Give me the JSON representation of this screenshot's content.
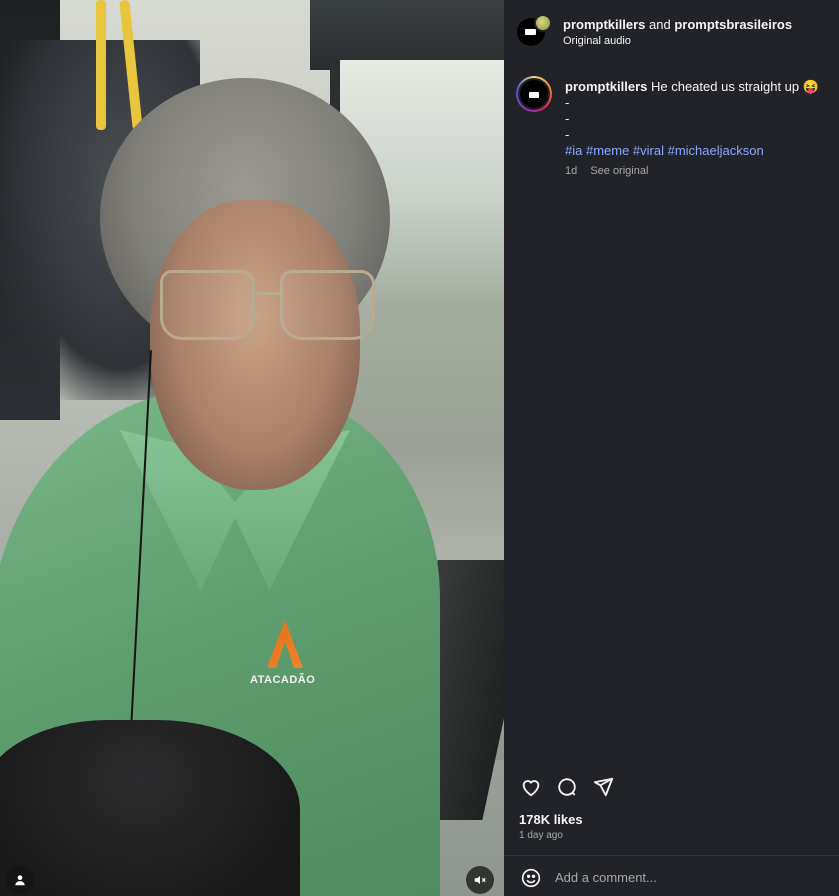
{
  "post": {
    "author_primary": "promptkillers",
    "joiner": "and",
    "author_secondary": "promptsbrasileiros",
    "audio": "Original audio"
  },
  "caption": {
    "username": "promptkillers",
    "text": "He cheated us straight up 😝",
    "lines": [
      "-",
      "-",
      "-"
    ],
    "hashtags": "#ia #meme #viral #michaeljackson",
    "time": "1d",
    "see_original": "See original"
  },
  "media": {
    "shirt_logo": "ATACADÃO"
  },
  "stats": {
    "likes": "178K likes",
    "ago": "1 day ago"
  },
  "comment": {
    "placeholder": "Add a comment..."
  },
  "icons": {
    "like": "heart-icon",
    "comment": "comment-icon",
    "share": "send-icon",
    "emoji": "smiley-icon",
    "user": "user-icon",
    "mute": "speaker-muted-icon"
  },
  "colors": {
    "panel_bg": "#212328",
    "hashtag": "#8aa7ff",
    "muted_text": "#a8a8a8"
  }
}
